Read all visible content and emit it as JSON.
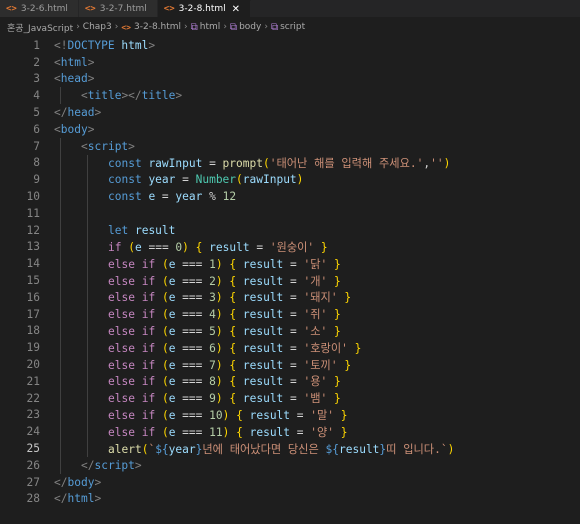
{
  "tabs": [
    {
      "icon": "<>",
      "label": "3-2-6.html",
      "active": false
    },
    {
      "icon": "<>",
      "label": "3-2-7.html",
      "active": false
    },
    {
      "icon": "<>",
      "label": "3-2-8.html",
      "active": true,
      "close": "✕"
    }
  ],
  "breadcrumb": {
    "items": [
      "혼공_JavaScript",
      "Chap3",
      "3-2-8.html",
      "html",
      "body",
      "script"
    ],
    "separator": "›"
  },
  "editor": {
    "current_line": 25,
    "lines": [
      {
        "n": "1",
        "indent": 0,
        "tokens": [
          [
            "punct",
            "<!"
          ],
          [
            "tag",
            "DOCTYPE"
          ],
          [
            "op",
            " "
          ],
          [
            "var",
            "html"
          ],
          [
            "punct",
            ">"
          ]
        ]
      },
      {
        "n": "2",
        "indent": 0,
        "tokens": [
          [
            "punct",
            "<"
          ],
          [
            "tag",
            "html"
          ],
          [
            "punct",
            ">"
          ]
        ]
      },
      {
        "n": "3",
        "indent": 0,
        "tokens": [
          [
            "punct",
            "<"
          ],
          [
            "tag",
            "head"
          ],
          [
            "punct",
            ">"
          ]
        ]
      },
      {
        "n": "4",
        "indent": 1,
        "tokens": [
          [
            "punct",
            "<"
          ],
          [
            "tag",
            "title"
          ],
          [
            "punct",
            "></"
          ],
          [
            "tag",
            "title"
          ],
          [
            "punct",
            ">"
          ]
        ]
      },
      {
        "n": "5",
        "indent": 0,
        "tokens": [
          [
            "punct",
            "</"
          ],
          [
            "tag",
            "head"
          ],
          [
            "punct",
            ">"
          ]
        ]
      },
      {
        "n": "6",
        "indent": 0,
        "tokens": [
          [
            "punct",
            "<"
          ],
          [
            "tag",
            "body"
          ],
          [
            "punct",
            ">"
          ]
        ]
      },
      {
        "n": "7",
        "indent": 1,
        "tokens": [
          [
            "punct",
            "<"
          ],
          [
            "tag",
            "script"
          ],
          [
            "punct",
            ">"
          ]
        ]
      },
      {
        "n": "8",
        "indent": 2,
        "tokens": [
          [
            "kw",
            "const"
          ],
          [
            "op",
            " "
          ],
          [
            "var",
            "rawInput"
          ],
          [
            "op",
            " = "
          ],
          [
            "fn",
            "prompt"
          ],
          [
            "brace",
            "("
          ],
          [
            "str",
            "'태어난 해를 입력해 주세요.'"
          ],
          [
            "op",
            ","
          ],
          [
            "str",
            "''"
          ],
          [
            "brace",
            ")"
          ]
        ]
      },
      {
        "n": "9",
        "indent": 2,
        "tokens": [
          [
            "kw",
            "const"
          ],
          [
            "op",
            " "
          ],
          [
            "var",
            "year"
          ],
          [
            "op",
            " = "
          ],
          [
            "cls",
            "Number"
          ],
          [
            "brace",
            "("
          ],
          [
            "var",
            "rawInput"
          ],
          [
            "brace",
            ")"
          ]
        ]
      },
      {
        "n": "10",
        "indent": 2,
        "tokens": [
          [
            "kw",
            "const"
          ],
          [
            "op",
            " "
          ],
          [
            "var",
            "e"
          ],
          [
            "op",
            " = "
          ],
          [
            "var",
            "year"
          ],
          [
            "op",
            " % "
          ],
          [
            "num",
            "12"
          ]
        ]
      },
      {
        "n": "11",
        "indent": 0,
        "tokens": []
      },
      {
        "n": "12",
        "indent": 2,
        "tokens": [
          [
            "kw",
            "let"
          ],
          [
            "op",
            " "
          ],
          [
            "var",
            "result"
          ]
        ]
      },
      {
        "n": "13",
        "indent": 2,
        "tokens": [
          [
            "ctrl",
            "if"
          ],
          [
            "op",
            " "
          ],
          [
            "brace",
            "("
          ],
          [
            "var",
            "e"
          ],
          [
            "op",
            " === "
          ],
          [
            "num",
            "0"
          ],
          [
            "brace",
            ")"
          ],
          [
            "op",
            " "
          ],
          [
            "brace",
            "{"
          ],
          [
            "op",
            " "
          ],
          [
            "var",
            "result"
          ],
          [
            "op",
            " = "
          ],
          [
            "str",
            "'원숭이'"
          ],
          [
            "op",
            " "
          ],
          [
            "brace",
            "}"
          ]
        ]
      },
      {
        "n": "14",
        "indent": 2,
        "tokens": [
          [
            "ctrl",
            "else"
          ],
          [
            "op",
            " "
          ],
          [
            "ctrl",
            "if"
          ],
          [
            "op",
            " "
          ],
          [
            "brace",
            "("
          ],
          [
            "var",
            "e"
          ],
          [
            "op",
            " === "
          ],
          [
            "num",
            "1"
          ],
          [
            "brace",
            ")"
          ],
          [
            "op",
            " "
          ],
          [
            "brace",
            "{"
          ],
          [
            "op",
            " "
          ],
          [
            "var",
            "result"
          ],
          [
            "op",
            " = "
          ],
          [
            "str",
            "'닭'"
          ],
          [
            "op",
            " "
          ],
          [
            "brace",
            "}"
          ]
        ]
      },
      {
        "n": "15",
        "indent": 2,
        "tokens": [
          [
            "ctrl",
            "else"
          ],
          [
            "op",
            " "
          ],
          [
            "ctrl",
            "if"
          ],
          [
            "op",
            " "
          ],
          [
            "brace",
            "("
          ],
          [
            "var",
            "e"
          ],
          [
            "op",
            " === "
          ],
          [
            "num",
            "2"
          ],
          [
            "brace",
            ")"
          ],
          [
            "op",
            " "
          ],
          [
            "brace",
            "{"
          ],
          [
            "op",
            " "
          ],
          [
            "var",
            "result"
          ],
          [
            "op",
            " = "
          ],
          [
            "str",
            "'개'"
          ],
          [
            "op",
            " "
          ],
          [
            "brace",
            "}"
          ]
        ]
      },
      {
        "n": "16",
        "indent": 2,
        "tokens": [
          [
            "ctrl",
            "else"
          ],
          [
            "op",
            " "
          ],
          [
            "ctrl",
            "if"
          ],
          [
            "op",
            " "
          ],
          [
            "brace",
            "("
          ],
          [
            "var",
            "e"
          ],
          [
            "op",
            " === "
          ],
          [
            "num",
            "3"
          ],
          [
            "brace",
            ")"
          ],
          [
            "op",
            " "
          ],
          [
            "brace",
            "{"
          ],
          [
            "op",
            " "
          ],
          [
            "var",
            "result"
          ],
          [
            "op",
            " = "
          ],
          [
            "str",
            "'돼지'"
          ],
          [
            "op",
            " "
          ],
          [
            "brace",
            "}"
          ]
        ]
      },
      {
        "n": "17",
        "indent": 2,
        "tokens": [
          [
            "ctrl",
            "else"
          ],
          [
            "op",
            " "
          ],
          [
            "ctrl",
            "if"
          ],
          [
            "op",
            " "
          ],
          [
            "brace",
            "("
          ],
          [
            "var",
            "e"
          ],
          [
            "op",
            " === "
          ],
          [
            "num",
            "4"
          ],
          [
            "brace",
            ")"
          ],
          [
            "op",
            " "
          ],
          [
            "brace",
            "{"
          ],
          [
            "op",
            " "
          ],
          [
            "var",
            "result"
          ],
          [
            "op",
            " = "
          ],
          [
            "str",
            "'쥐'"
          ],
          [
            "op",
            " "
          ],
          [
            "brace",
            "}"
          ]
        ]
      },
      {
        "n": "18",
        "indent": 2,
        "tokens": [
          [
            "ctrl",
            "else"
          ],
          [
            "op",
            " "
          ],
          [
            "ctrl",
            "if"
          ],
          [
            "op",
            " "
          ],
          [
            "brace",
            "("
          ],
          [
            "var",
            "e"
          ],
          [
            "op",
            " === "
          ],
          [
            "num",
            "5"
          ],
          [
            "brace",
            ")"
          ],
          [
            "op",
            " "
          ],
          [
            "brace",
            "{"
          ],
          [
            "op",
            " "
          ],
          [
            "var",
            "result"
          ],
          [
            "op",
            " = "
          ],
          [
            "str",
            "'소'"
          ],
          [
            "op",
            " "
          ],
          [
            "brace",
            "}"
          ]
        ]
      },
      {
        "n": "19",
        "indent": 2,
        "tokens": [
          [
            "ctrl",
            "else"
          ],
          [
            "op",
            " "
          ],
          [
            "ctrl",
            "if"
          ],
          [
            "op",
            " "
          ],
          [
            "brace",
            "("
          ],
          [
            "var",
            "e"
          ],
          [
            "op",
            " === "
          ],
          [
            "num",
            "6"
          ],
          [
            "brace",
            ")"
          ],
          [
            "op",
            " "
          ],
          [
            "brace",
            "{"
          ],
          [
            "op",
            " "
          ],
          [
            "var",
            "result"
          ],
          [
            "op",
            " = "
          ],
          [
            "str",
            "'호랑이'"
          ],
          [
            "op",
            " "
          ],
          [
            "brace",
            "}"
          ]
        ]
      },
      {
        "n": "20",
        "indent": 2,
        "tokens": [
          [
            "ctrl",
            "else"
          ],
          [
            "op",
            " "
          ],
          [
            "ctrl",
            "if"
          ],
          [
            "op",
            " "
          ],
          [
            "brace",
            "("
          ],
          [
            "var",
            "e"
          ],
          [
            "op",
            " === "
          ],
          [
            "num",
            "7"
          ],
          [
            "brace",
            ")"
          ],
          [
            "op",
            " "
          ],
          [
            "brace",
            "{"
          ],
          [
            "op",
            " "
          ],
          [
            "var",
            "result"
          ],
          [
            "op",
            " = "
          ],
          [
            "str",
            "'토끼'"
          ],
          [
            "op",
            " "
          ],
          [
            "brace",
            "}"
          ]
        ]
      },
      {
        "n": "21",
        "indent": 2,
        "tokens": [
          [
            "ctrl",
            "else"
          ],
          [
            "op",
            " "
          ],
          [
            "ctrl",
            "if"
          ],
          [
            "op",
            " "
          ],
          [
            "brace",
            "("
          ],
          [
            "var",
            "e"
          ],
          [
            "op",
            " === "
          ],
          [
            "num",
            "8"
          ],
          [
            "brace",
            ")"
          ],
          [
            "op",
            " "
          ],
          [
            "brace",
            "{"
          ],
          [
            "op",
            " "
          ],
          [
            "var",
            "result"
          ],
          [
            "op",
            " = "
          ],
          [
            "str",
            "'용'"
          ],
          [
            "op",
            " "
          ],
          [
            "brace",
            "}"
          ]
        ]
      },
      {
        "n": "22",
        "indent": 2,
        "tokens": [
          [
            "ctrl",
            "else"
          ],
          [
            "op",
            " "
          ],
          [
            "ctrl",
            "if"
          ],
          [
            "op",
            " "
          ],
          [
            "brace",
            "("
          ],
          [
            "var",
            "e"
          ],
          [
            "op",
            " === "
          ],
          [
            "num",
            "9"
          ],
          [
            "brace",
            ")"
          ],
          [
            "op",
            " "
          ],
          [
            "brace",
            "{"
          ],
          [
            "op",
            " "
          ],
          [
            "var",
            "result"
          ],
          [
            "op",
            " = "
          ],
          [
            "str",
            "'뱀'"
          ],
          [
            "op",
            " "
          ],
          [
            "brace",
            "}"
          ]
        ]
      },
      {
        "n": "23",
        "indent": 2,
        "tokens": [
          [
            "ctrl",
            "else"
          ],
          [
            "op",
            " "
          ],
          [
            "ctrl",
            "if"
          ],
          [
            "op",
            " "
          ],
          [
            "brace",
            "("
          ],
          [
            "var",
            "e"
          ],
          [
            "op",
            " === "
          ],
          [
            "num",
            "10"
          ],
          [
            "brace",
            ")"
          ],
          [
            "op",
            " "
          ],
          [
            "brace",
            "{"
          ],
          [
            "op",
            " "
          ],
          [
            "var",
            "result"
          ],
          [
            "op",
            " = "
          ],
          [
            "str",
            "'말'"
          ],
          [
            "op",
            " "
          ],
          [
            "brace",
            "}"
          ]
        ]
      },
      {
        "n": "24",
        "indent": 2,
        "tokens": [
          [
            "ctrl",
            "else"
          ],
          [
            "op",
            " "
          ],
          [
            "ctrl",
            "if"
          ],
          [
            "op",
            " "
          ],
          [
            "brace",
            "("
          ],
          [
            "var",
            "e"
          ],
          [
            "op",
            " === "
          ],
          [
            "num",
            "11"
          ],
          [
            "brace",
            ")"
          ],
          [
            "op",
            " "
          ],
          [
            "brace",
            "{"
          ],
          [
            "op",
            " "
          ],
          [
            "var",
            "result"
          ],
          [
            "op",
            " = "
          ],
          [
            "str",
            "'양'"
          ],
          [
            "op",
            " "
          ],
          [
            "brace",
            "}"
          ]
        ]
      },
      {
        "n": "25",
        "indent": 2,
        "tokens": [
          [
            "fn",
            "alert"
          ],
          [
            "brace",
            "("
          ],
          [
            "str",
            "`"
          ],
          [
            "tplbrace",
            "${"
          ],
          [
            "var",
            "year"
          ],
          [
            "tplbrace",
            "}"
          ],
          [
            "str",
            "년에 태어났다면 당신은 "
          ],
          [
            "tplbrace",
            "${"
          ],
          [
            "var",
            "result"
          ],
          [
            "tplbrace",
            "}"
          ],
          [
            "str",
            "띠 입니다.`"
          ],
          [
            "brace",
            ")"
          ]
        ]
      },
      {
        "n": "26",
        "indent": 1,
        "tokens": [
          [
            "punct",
            "</"
          ],
          [
            "tag",
            "script"
          ],
          [
            "punct",
            ">"
          ]
        ]
      },
      {
        "n": "27",
        "indent": 0,
        "tokens": [
          [
            "punct",
            "</"
          ],
          [
            "tag",
            "body"
          ],
          [
            "punct",
            ">"
          ]
        ]
      },
      {
        "n": "28",
        "indent": 0,
        "tokens": [
          [
            "punct",
            "</"
          ],
          [
            "tag",
            "html"
          ],
          [
            "punct",
            ">"
          ]
        ]
      }
    ]
  }
}
